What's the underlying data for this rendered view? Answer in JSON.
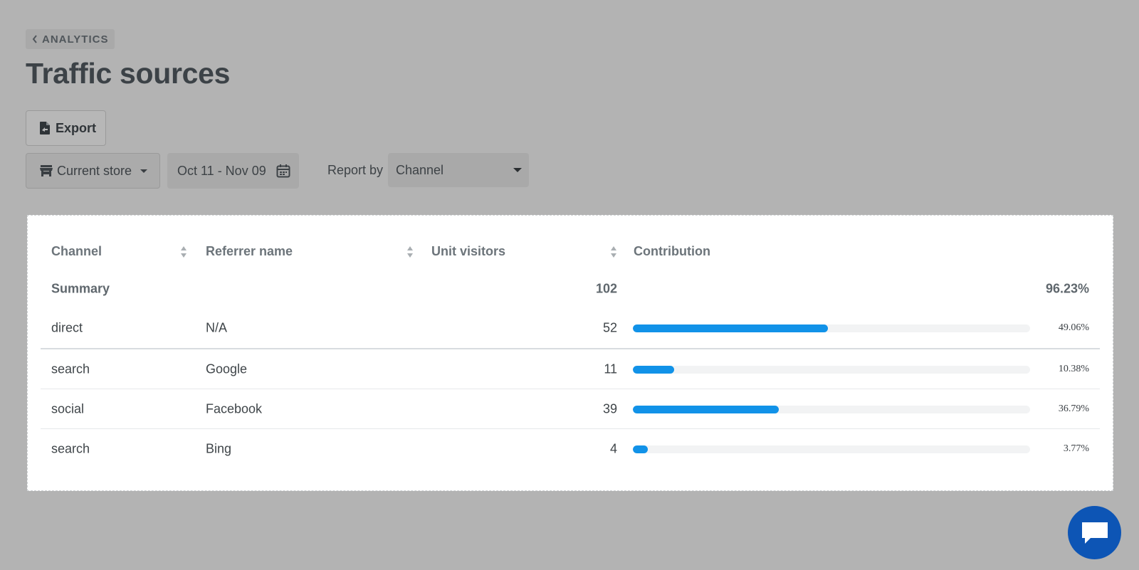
{
  "breadcrumb": {
    "label": "ANALYTICS"
  },
  "page": {
    "title": "Traffic sources"
  },
  "toolbar": {
    "export_label": "Export"
  },
  "filters": {
    "store_label": "Current store",
    "date_range": "Oct 11 - Nov 09",
    "report_by_label": "Report by",
    "report_by_value": "Channel"
  },
  "table": {
    "columns": [
      "Channel",
      "Referrer name",
      "Unit visitors",
      "Contribution"
    ],
    "summary": {
      "label": "Summary",
      "visitors": "102",
      "contribution": "96.23%"
    },
    "rows": [
      {
        "channel": "direct",
        "referrer": "N/A",
        "visitors": "52",
        "contribution": "49.06%",
        "share": 0.4906
      },
      {
        "channel": "search",
        "referrer": "Google",
        "visitors": "11",
        "contribution": "10.38%",
        "share": 0.1038
      },
      {
        "channel": "social",
        "referrer": "Facebook",
        "visitors": "39",
        "contribution": "36.79%",
        "share": 0.3679
      },
      {
        "channel": "search",
        "referrer": "Bing",
        "visitors": "4",
        "contribution": "3.77%",
        "share": 0.0377
      }
    ]
  },
  "colors": {
    "bar_fill": "#1192e8",
    "bar_track": "#f2f3f4",
    "chat_button": "#0d55b5",
    "overlay": "#b3b3b3"
  },
  "icons": [
    "chevron-left-icon",
    "file-export-icon",
    "store-icon",
    "caret-down-icon",
    "calendar-icon",
    "sort-icon",
    "chat-bubble-icon"
  ]
}
